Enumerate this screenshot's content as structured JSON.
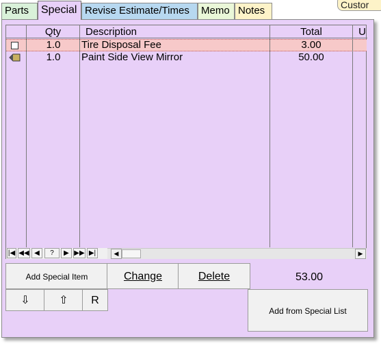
{
  "tabs": {
    "parts": "Parts",
    "special": "Special",
    "revise": "Revise Estimate/Times",
    "memo": "Memo",
    "notes": "Notes",
    "custom": "Custor"
  },
  "grid": {
    "columns": [
      "Qty",
      "Description",
      "Total",
      "U"
    ],
    "rows": [
      {
        "qty": "1.0",
        "description": "Tire Disposal Fee",
        "total": "3.00",
        "selected": true
      },
      {
        "qty": "1.0",
        "description": "Paint Side View Mirror",
        "total": "50.00",
        "selected": false
      }
    ],
    "nav_buttons": [
      "|◀",
      "◀◀",
      "◀",
      "?",
      "▶",
      "▶▶",
      "▶|"
    ]
  },
  "buttons": {
    "add_special_item": "Add Special Item",
    "change": "Change",
    "delete": "Delete",
    "move_down": "⇩",
    "move_up": "⇧",
    "r": "R",
    "add_from_special_list": "Add from Special List"
  },
  "summary": {
    "total": "53.00"
  },
  "colors": {
    "panel_bg": "#e8d0f8",
    "selected_row": "#f7c9c9"
  }
}
